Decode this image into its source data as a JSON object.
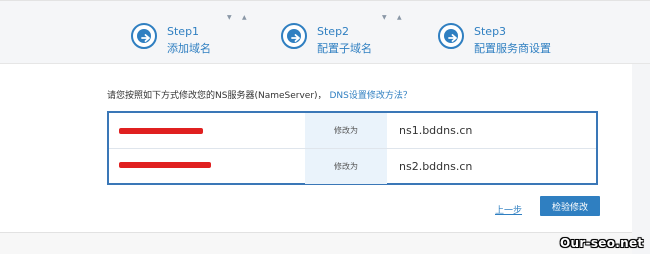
{
  "steps": [
    {
      "title": "Step1",
      "subtitle": "添加域名",
      "icon": "arrow-right-icon"
    },
    {
      "title": "Step2",
      "subtitle": "配置子域名",
      "icon": "arrow-right-icon"
    },
    {
      "title": "Step3",
      "subtitle": "配置服务商设置",
      "icon": "arrow-right-icon"
    }
  ],
  "instruction": {
    "text": "请您按照如下方式修改您的NS服务器(NameServer)",
    "separator": "，",
    "help_link": "DNS设置修改方法？"
  },
  "nameservers": {
    "rows": [
      {
        "domain_redacted": true,
        "label": "修改为",
        "value": "ns1.bddns.cn"
      },
      {
        "domain_redacted": true,
        "label": "修改为",
        "value": "ns2.bddns.cn"
      }
    ]
  },
  "actions": {
    "prev_label": "上一步",
    "check_label": "检验修改"
  },
  "watermark": "Our-seo.net",
  "colors": {
    "accent": "#2f7fc1",
    "table_border": "#3a77b7",
    "redaction": "#e02020",
    "label_bg": "#eaf3fb"
  }
}
